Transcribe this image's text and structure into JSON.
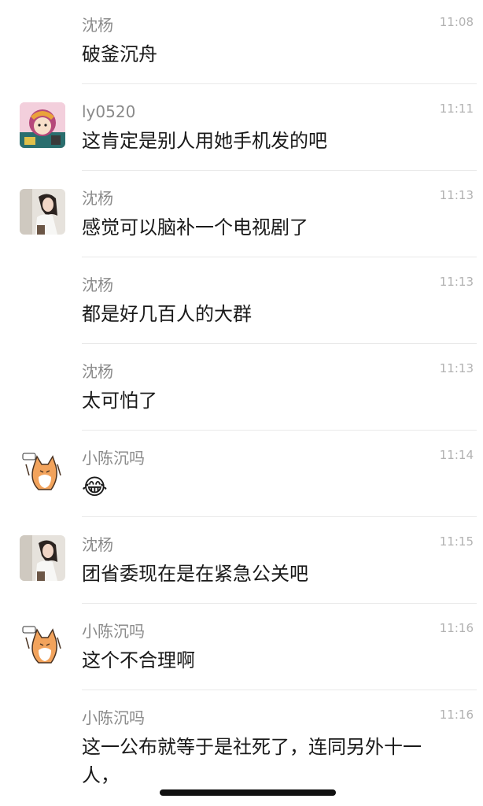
{
  "messages": [
    {
      "sender": "沈杨",
      "time": "11:08",
      "text": "破釜沉舟",
      "avatar": "none"
    },
    {
      "sender": "ly0520",
      "time": "11:11",
      "text": "这肯定是别人用她手机发的吧",
      "avatar": "anime-girl-avatar"
    },
    {
      "sender": "沈杨",
      "time": "11:13",
      "text": "感觉可以脑补一个电视剧了",
      "avatar": "woman-photo-avatar"
    },
    {
      "sender": "沈杨",
      "time": "11:13",
      "text": "都是好几百人的大群",
      "avatar": "none"
    },
    {
      "sender": "沈杨",
      "time": "11:13",
      "text": "太可怕了",
      "avatar": "none"
    },
    {
      "sender": "小陈沉吗",
      "time": "11:14",
      "text": "😂",
      "avatar": "cat-sticker-avatar"
    },
    {
      "sender": "沈杨",
      "time": "11:15",
      "text": "团省委现在是在紧急公关吧",
      "avatar": "woman-photo-avatar"
    },
    {
      "sender": "小陈沉吗",
      "time": "11:16",
      "text": "这个不合理啊",
      "avatar": "cat-sticker-avatar"
    },
    {
      "sender": "小陈沉吗",
      "time": "11:16",
      "text": "这一公布就等于是社死了，连同另外十一人，",
      "avatar": "none"
    }
  ],
  "colors": {
    "sender": "#8a8a8a",
    "time": "#b2b2b2",
    "text": "#1a1a1a",
    "divider": "#e9e9e9",
    "background": "#ffffff"
  }
}
